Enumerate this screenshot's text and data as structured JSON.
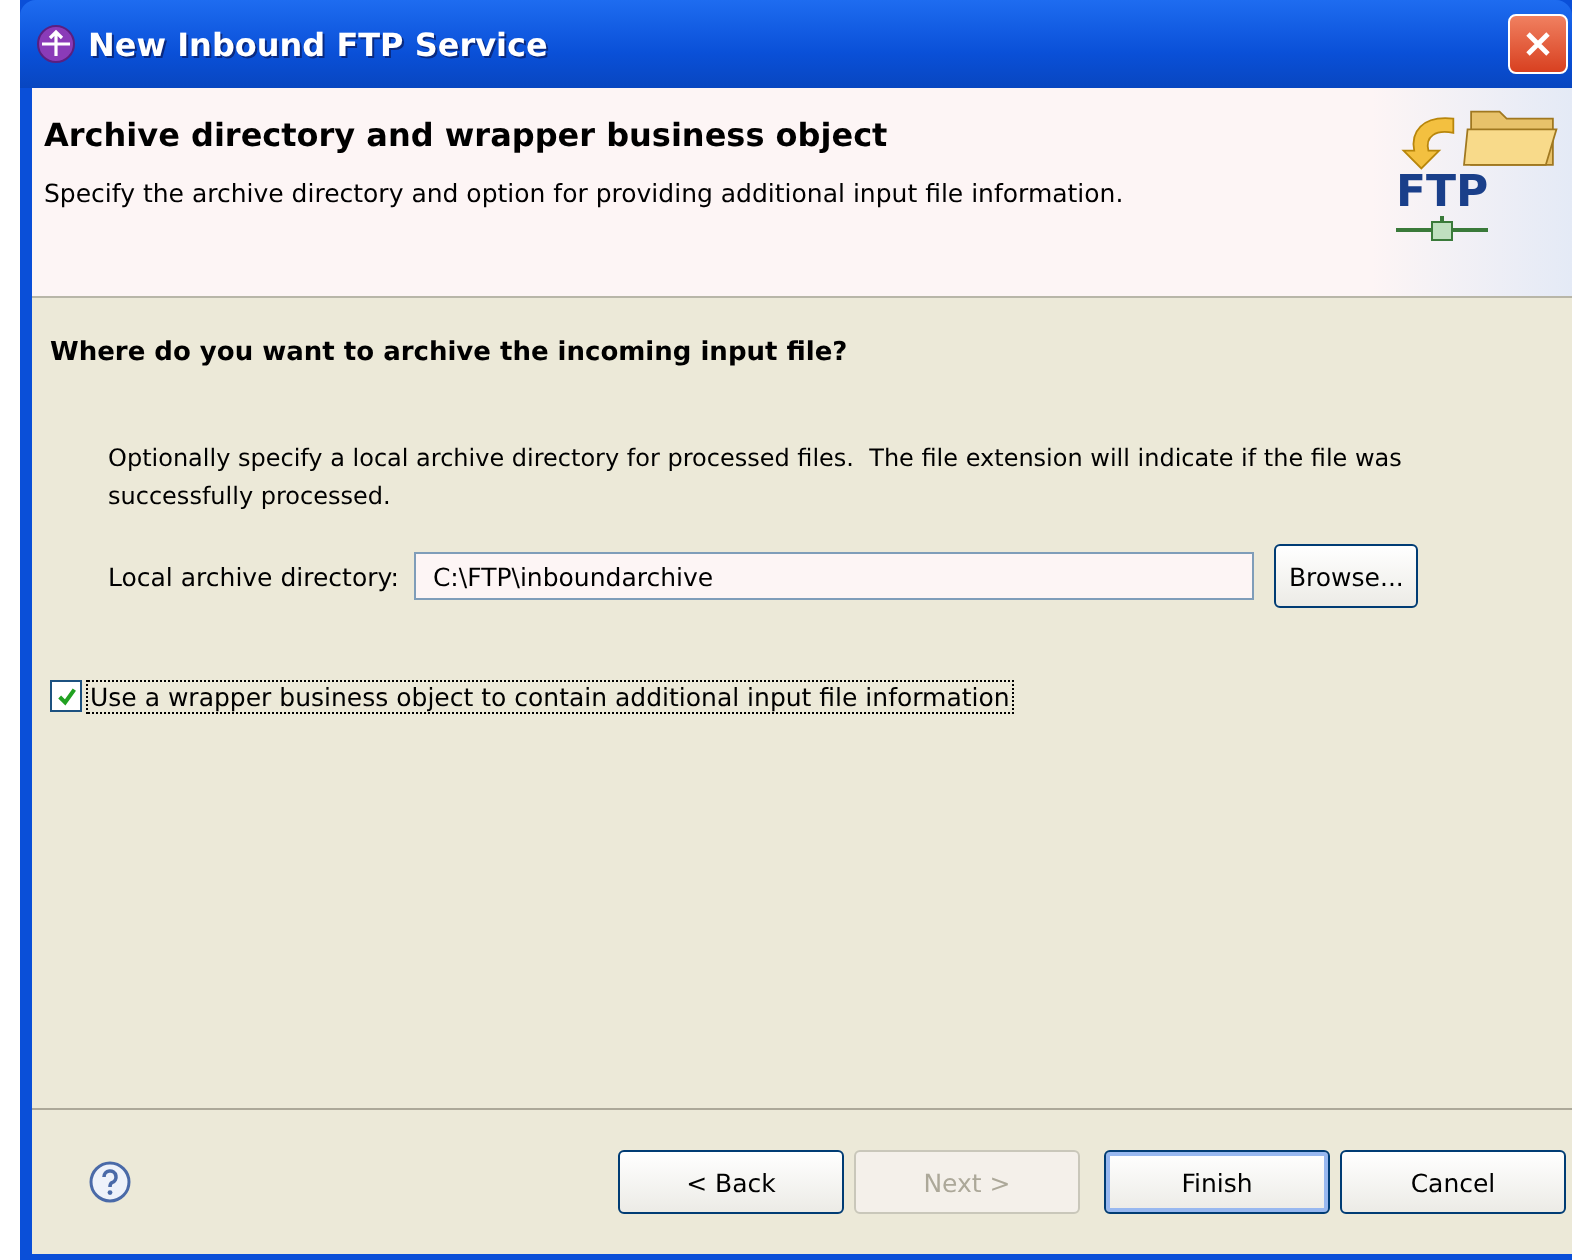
{
  "window": {
    "title": "New Inbound FTP Service"
  },
  "banner": {
    "title": "Archive directory and wrapper business object",
    "description": "Specify the archive directory and option for providing additional input file information.",
    "logo_text": "FTP"
  },
  "section": {
    "heading": "Where do you want to archive the incoming input file?",
    "description": "Optionally specify a local archive directory for processed files.  The file extension will indicate if the file was successfully processed.",
    "field_label": "Local archive directory:",
    "field_value": "C:\\FTP\\inboundarchive",
    "browse_label": "Browse..."
  },
  "wrapper_option": {
    "label": "Use a wrapper business object to contain additional input file information",
    "checked": true
  },
  "buttons": [
    {
      "label": "< Back",
      "disabled": false,
      "default": false
    },
    {
      "label": "Next >",
      "disabled": true,
      "default": false
    },
    {
      "label": "Finish",
      "disabled": false,
      "default": true
    },
    {
      "label": "Cancel",
      "disabled": false,
      "default": false
    }
  ]
}
